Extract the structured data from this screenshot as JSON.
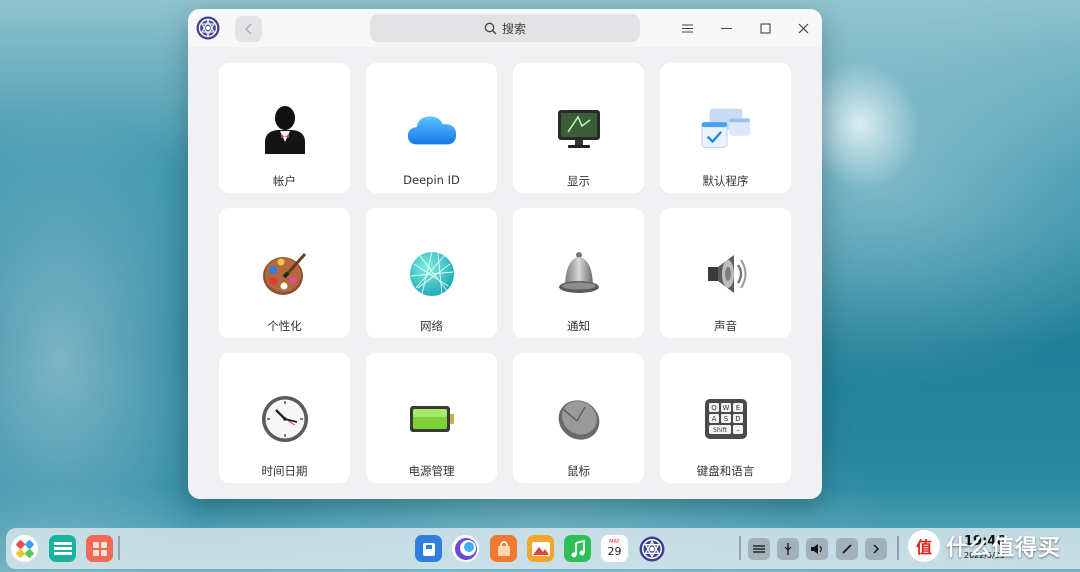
{
  "window": {
    "search_placeholder": "搜索",
    "back_icon": "chevron-left-icon",
    "menu_icon": "hamburger-icon",
    "minimize_icon": "minimize-icon",
    "maximize_icon": "maximize-icon",
    "close_icon": "close-icon"
  },
  "modules": [
    {
      "label": "帐户",
      "icon": "account-icon"
    },
    {
      "label": "Deepin ID",
      "icon": "cloud-icon"
    },
    {
      "label": "显示",
      "icon": "display-icon"
    },
    {
      "label": "默认程序",
      "icon": "default-apps-icon"
    },
    {
      "label": "个性化",
      "icon": "palette-icon"
    },
    {
      "label": "网络",
      "icon": "network-globe-icon"
    },
    {
      "label": "通知",
      "icon": "bell-icon"
    },
    {
      "label": "声音",
      "icon": "speaker-icon"
    },
    {
      "label": "时间日期",
      "icon": "clock-icon"
    },
    {
      "label": "电源管理",
      "icon": "battery-icon"
    },
    {
      "label": "鼠标",
      "icon": "mouse-icon"
    },
    {
      "label": "键盘和语言",
      "icon": "keyboard-icon"
    }
  ],
  "dock": {
    "calendar_month": "MAY",
    "calendar_day": "29",
    "clock_time": "19:46",
    "clock_date": "2022/5/29"
  },
  "watermark": {
    "badge": "值",
    "text": "什么值得买"
  },
  "colors": {
    "window_bg": "#f1f1f3",
    "card_bg": "#ffffff",
    "accent": "#2b8aa2"
  }
}
